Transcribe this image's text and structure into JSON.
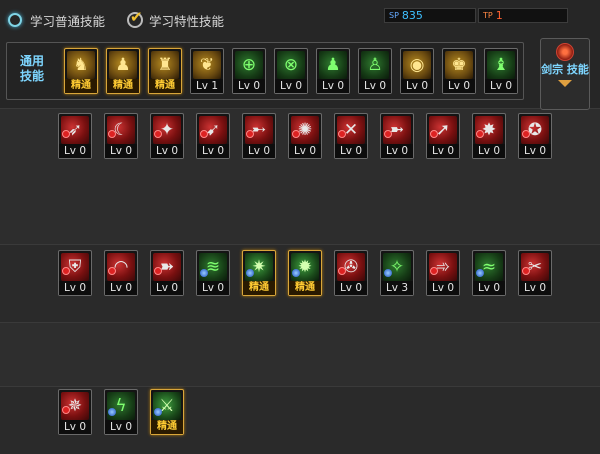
{
  "tabs": [
    {
      "label": "学习普通技能",
      "selected": false
    },
    {
      "label": "学习特性技能",
      "selected": true
    }
  ],
  "stats": {
    "sp_label": "SP",
    "sp_value": "835",
    "tp_label": "TP",
    "tp_value": "1"
  },
  "common_label": "通用 技能",
  "class_button_label": "剑宗 技能",
  "common_skills": [
    {
      "level": "精通",
      "icon": "sit-figure-icon",
      "color": "gold"
    },
    {
      "level": "精通",
      "icon": "crouch-figure-icon",
      "color": "gold"
    },
    {
      "level": "精通",
      "icon": "kick-figure-icon",
      "color": "gold"
    },
    {
      "level": "Lv 1",
      "icon": "wings-icon",
      "color": "gold"
    },
    {
      "level": "Lv 0",
      "icon": "crosshair-icon",
      "color": "green"
    },
    {
      "level": "Lv 0",
      "icon": "crosshair-plus-icon",
      "color": "green"
    },
    {
      "level": "Lv 0",
      "icon": "figure-strike-icon",
      "color": "green"
    },
    {
      "level": "Lv 0",
      "icon": "figure-guard-icon",
      "color": "green"
    },
    {
      "level": "Lv 0",
      "icon": "eye-icon",
      "color": "gold"
    },
    {
      "level": "Lv 0",
      "icon": "figure-power-icon",
      "color": "gold"
    },
    {
      "level": "Lv 0",
      "icon": "figure-jump-icon",
      "color": "green"
    }
  ],
  "row1": [
    {
      "level": "Lv 0",
      "icon": "slash-icon",
      "color": "red"
    },
    {
      "level": "Lv 0",
      "icon": "crescent-icon",
      "color": "red"
    },
    {
      "level": "Lv 0",
      "icon": "blade-swirl-icon",
      "color": "red"
    },
    {
      "level": "Lv 0",
      "icon": "sword-wave-icon",
      "color": "red"
    },
    {
      "level": "Lv 0",
      "icon": "spear-icon",
      "color": "red"
    },
    {
      "level": "Lv 0",
      "icon": "spin-icon",
      "color": "red"
    },
    {
      "level": "Lv 0",
      "icon": "cross-slash-icon",
      "color": "red"
    },
    {
      "level": "Lv 0",
      "icon": "dash-icon",
      "color": "red"
    },
    {
      "level": "Lv 0",
      "icon": "leap-icon",
      "color": "red"
    },
    {
      "level": "Lv 0",
      "icon": "strike-icon",
      "color": "red"
    },
    {
      "level": "Lv 0",
      "icon": "whirl-icon",
      "color": "red"
    }
  ],
  "row2": [
    {
      "level": "Lv 0",
      "icon": "shield-icon",
      "color": "red"
    },
    {
      "level": "Lv 0",
      "icon": "arc-icon",
      "color": "red"
    },
    {
      "level": "Lv 0",
      "icon": "rush-icon",
      "color": "red"
    },
    {
      "level": "Lv 0",
      "icon": "wind-icon",
      "color": "green"
    },
    {
      "level": "精通",
      "icon": "burst-icon",
      "color": "greenglow"
    },
    {
      "level": "精通",
      "icon": "flash-icon",
      "color": "greenglow"
    },
    {
      "level": "Lv 0",
      "icon": "vortex-icon",
      "color": "red"
    },
    {
      "level": "Lv 3",
      "icon": "sparkle-icon",
      "color": "green"
    },
    {
      "level": "Lv 0",
      "icon": "flurry-icon",
      "color": "red"
    },
    {
      "level": "Lv 0",
      "icon": "gale-icon",
      "color": "green"
    },
    {
      "level": "Lv 0",
      "icon": "cleave-icon",
      "color": "red"
    }
  ],
  "row3": [
    {
      "level": "Lv 0",
      "icon": "flame-icon",
      "color": "red"
    },
    {
      "level": "Lv 0",
      "icon": "lightning-icon",
      "color": "green"
    },
    {
      "level": "精通",
      "icon": "blade-icon",
      "color": "greenglow"
    }
  ]
}
